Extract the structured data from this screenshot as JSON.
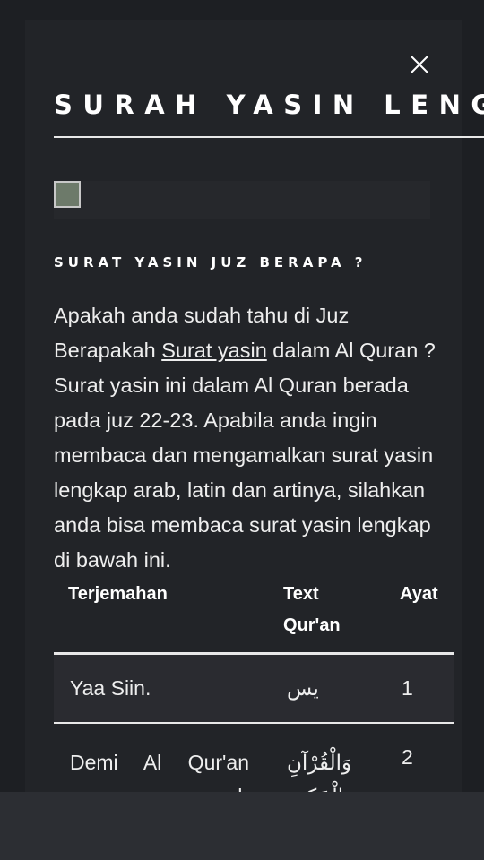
{
  "close_icon": "close-icon",
  "title": "SURAH YASIN LENGKAP",
  "section_heading": "SURAT YASIN JUZ BERAPA ?",
  "intro": {
    "before_link": "Apakah anda sudah tahu di Juz Berapakah ",
    "link_text": "Surat yasin",
    "after_link": " dalam Al Quran ? Surat yasin ini dalam Al Quran berada pada juz 22-23. Apabila anda ingin membaca dan mengamalkan surat yasin lengkap arab, latin dan artinya, silahkan anda bisa membaca surat yasin lengkap di bawah ini."
  },
  "table": {
    "headers": [
      "Terjemahan",
      "Text Qur'an",
      "Ayat"
    ],
    "rows": [
      {
        "translation": "Yaa Siin.",
        "arabic": "يس",
        "ayat": "1"
      },
      {
        "translation": "Demi Al Qur'an yang penuh",
        "arabic": "وَالْقُرْآنِ الْحَكِيمِ",
        "ayat": "2"
      }
    ]
  },
  "colors": {
    "background": "#1d1f23",
    "panel": "#222428",
    "text": "#ffffff",
    "highlight_row": "#2a2b30"
  }
}
